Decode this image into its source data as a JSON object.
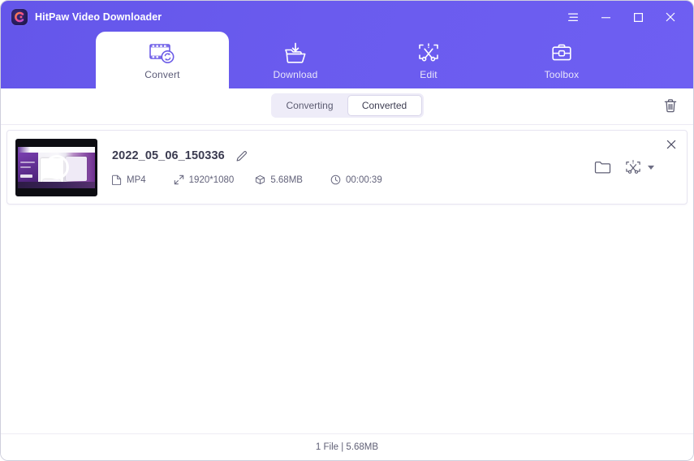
{
  "window": {
    "title": "HitPaw Video Downloader",
    "logo_icon": "hitpaw-c-logo",
    "controls": [
      {
        "name": "menu",
        "icon": "hamburger-menu-icon"
      },
      {
        "name": "minimize",
        "icon": "minimize-icon"
      },
      {
        "name": "maximize",
        "icon": "maximize-icon"
      },
      {
        "name": "close",
        "icon": "close-icon"
      }
    ]
  },
  "tabs": [
    {
      "label": "Convert",
      "icon": "film-convert-icon",
      "active": true
    },
    {
      "label": "Download",
      "icon": "folder-download-icon",
      "active": false
    },
    {
      "label": "Edit",
      "icon": "crop-scissors-icon",
      "active": false
    },
    {
      "label": "Toolbox",
      "icon": "toolbox-icon",
      "active": false
    }
  ],
  "toolbar": {
    "segments": [
      {
        "label": "Converting",
        "active": false
      },
      {
        "label": "Converted",
        "active": true
      }
    ],
    "delete_icon": "trash-icon"
  },
  "file_list": [
    {
      "name": "2022_05_06_150336",
      "rename_icon": "pencil-edit-icon",
      "thumbnail_icon": "video-thumbnail-play-icon",
      "meta": [
        {
          "icon": "file-icon",
          "value": "MP4"
        },
        {
          "icon": "resolution-icon",
          "value": "1920*1080"
        },
        {
          "icon": "filesize-icon",
          "value": "5.68MB"
        },
        {
          "icon": "clock-icon",
          "value": "00:00:39"
        }
      ],
      "actions": [
        {
          "name": "open-folder",
          "icon": "folder-icon"
        },
        {
          "name": "edit-video",
          "icon": "crop-scissors-icon"
        },
        {
          "name": "more",
          "icon": "chevron-down-icon"
        }
      ],
      "remove_icon": "close-icon"
    }
  ],
  "statusbar": {
    "summary": "1 File | 5.68MB"
  },
  "colors": {
    "header_purple": "#6A5BEE",
    "accent": "#6C5CE7",
    "active_tab_bg": "#FFFFFF",
    "segment_track": "#EEECF8",
    "text_dark": "#3B3B50",
    "text_muted": "#62627A",
    "card_border": "#E7E5F1"
  }
}
